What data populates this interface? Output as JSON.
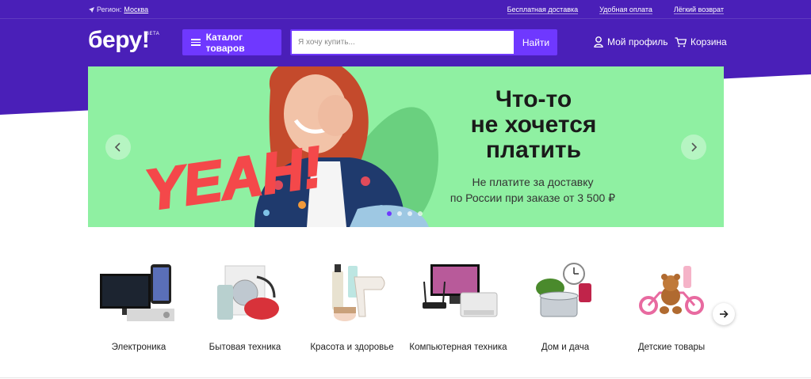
{
  "colors": {
    "brand_purple": "#4a1fb8",
    "accent_purple": "#6f38ff",
    "banner_green": "#8ff0a2",
    "yeah_red": "#f4484a"
  },
  "topbar": {
    "region_label": "Регион:",
    "region_value": "Москва",
    "links": [
      "Бесплатная доставка",
      "Удобная оплата",
      "Лёгкий возврат"
    ]
  },
  "header": {
    "logo": "беру!",
    "logo_badge": "BETA",
    "catalog_label": "Каталог товаров",
    "search_placeholder": "Я хочу купить...",
    "search_button": "Найти",
    "profile_label": "Мой профиль",
    "cart_label": "Корзина"
  },
  "banner": {
    "stamp": "YEAH!",
    "headline": [
      "Что-то",
      "не хочется",
      "платить"
    ],
    "subtext": [
      "Не платите за доставку",
      "по России при заказе от 3 500 ₽"
    ],
    "slides_count": 4,
    "active_slide": 1
  },
  "categories": [
    {
      "label": "Электроника",
      "icon": "tv-phone-icon"
    },
    {
      "label": "Бытовая техника",
      "icon": "appliances-icon"
    },
    {
      "label": "Красота и здоровье",
      "icon": "cosmetics-icon"
    },
    {
      "label": "Компьютерная техника",
      "icon": "computer-icon"
    },
    {
      "label": "Дом и дача",
      "icon": "home-icon"
    },
    {
      "label": "Детские товары",
      "icon": "kids-icon"
    }
  ]
}
